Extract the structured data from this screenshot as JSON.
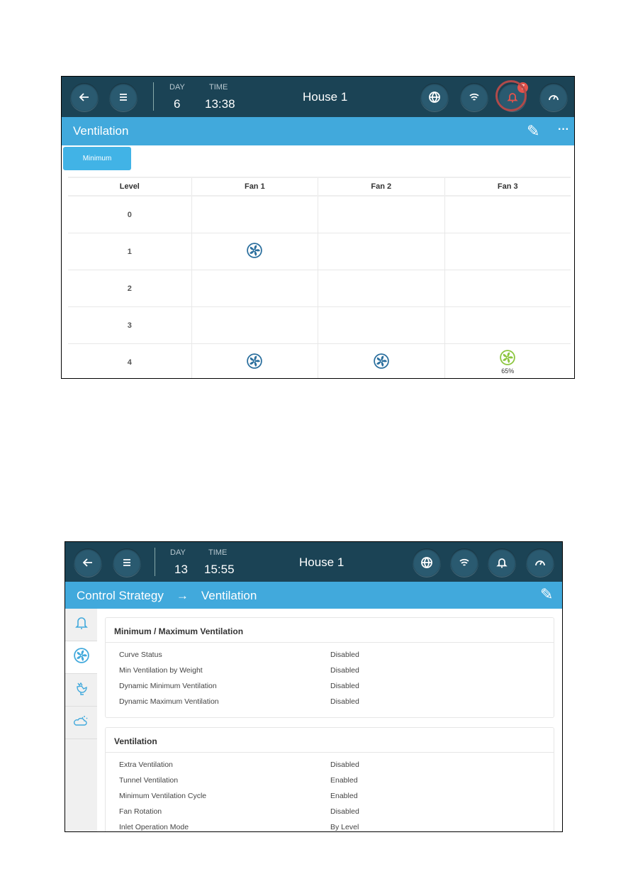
{
  "screen1": {
    "header": {
      "day_label": "DAY",
      "day": "6",
      "time_label": "TIME",
      "time": "13:38",
      "title": "House 1",
      "alarm_count": "7"
    },
    "bar_title": "Ventilation",
    "tab": "Minimum",
    "columns": [
      "Level",
      "Fan 1",
      "Fan 2",
      "Fan 3"
    ],
    "rows": [
      {
        "level": "0",
        "fans": [
          null,
          null,
          null
        ]
      },
      {
        "level": "1",
        "fans": [
          "on",
          null,
          null
        ]
      },
      {
        "level": "2",
        "fans": [
          null,
          null,
          null
        ]
      },
      {
        "level": "3",
        "fans": [
          null,
          null,
          null
        ]
      },
      {
        "level": "4",
        "fans": [
          "on",
          "on",
          "variable"
        ],
        "fan3_percent": "65%"
      }
    ],
    "colors": {
      "header": "#1b4355",
      "bar": "#41a9dc",
      "fan_on": "#2b6f9e",
      "fan_variable": "#8cc63f",
      "alarm": "#e5534b"
    }
  },
  "screen2": {
    "header": {
      "day_label": "DAY",
      "day": "13",
      "time_label": "TIME",
      "time": "15:55",
      "title": "House 1"
    },
    "breadcrumb": [
      "Control Strategy",
      "Ventilation"
    ],
    "breadcrumb_sep": "→",
    "sidebar": [
      "bell-icon",
      "fan-icon",
      "rooster-icon",
      "weather-icon"
    ],
    "cards": [
      {
        "title": "Minimum / Maximum Ventilation",
        "rows": [
          [
            "Curve Status",
            "Disabled"
          ],
          [
            "Min Ventilation by Weight",
            "Disabled"
          ],
          [
            "Dynamic Minimum Ventilation",
            "Disabled"
          ],
          [
            "Dynamic Maximum Ventilation",
            "Disabled"
          ]
        ]
      },
      {
        "title": "Ventilation",
        "rows": [
          [
            "Extra Ventilation",
            "Disabled"
          ],
          [
            "Tunnel Ventilation",
            "Enabled"
          ],
          [
            "Minimum Ventilation Cycle",
            "Enabled"
          ],
          [
            "Fan Rotation",
            "Disabled"
          ],
          [
            "Inlet Operation Mode",
            "By Level"
          ]
        ]
      }
    ]
  }
}
